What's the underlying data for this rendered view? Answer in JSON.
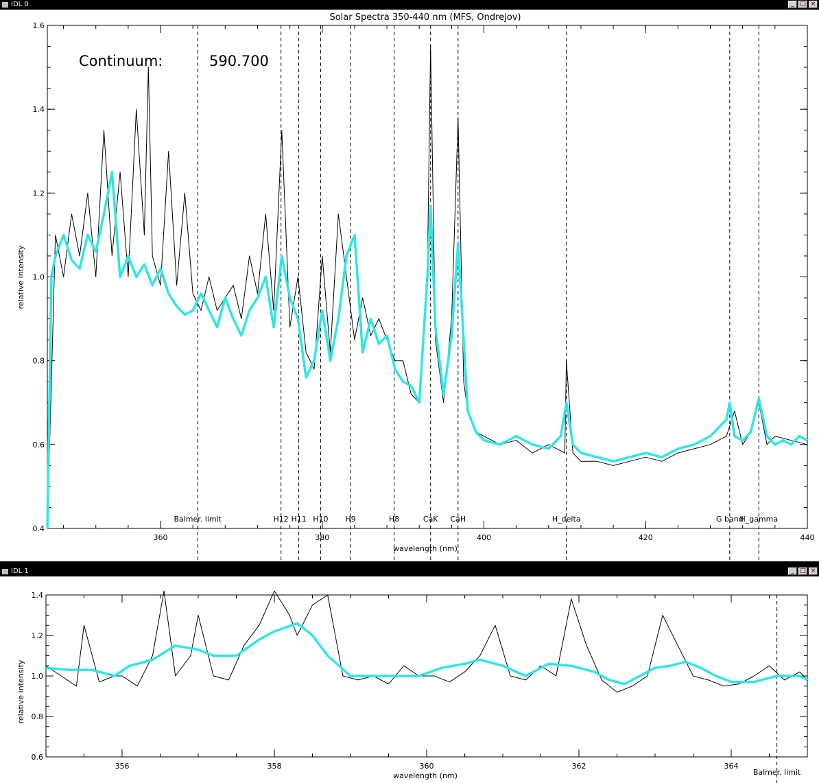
{
  "windows": [
    {
      "title": "IDL 0"
    },
    {
      "title": "IDL 1"
    }
  ],
  "window_buttons": {
    "minimize": "_",
    "maximize": "□",
    "close": "×"
  },
  "colors": {
    "spectrum": "#000000",
    "smoothed": "#2ee6e6",
    "background": "#ffffff"
  },
  "chart_data": [
    {
      "type": "line",
      "title": "Solar Spectra 350-440 nm (MFS, Ondrejov)",
      "xlabel": "wavelength (nm)",
      "ylabel": "relative intensity",
      "xlim": [
        346,
        440
      ],
      "ylim": [
        0.4,
        1.6
      ],
      "xticks": [
        360,
        380,
        400,
        420,
        440
      ],
      "yticks": [
        0.4,
        0.6,
        0.8,
        1.0,
        1.2,
        1.4,
        1.6
      ],
      "ytick_labels": [
        "0.4",
        "0.6",
        "0.8",
        "1.0",
        "1.2",
        "1.4",
        "1.6"
      ],
      "annotation_label": "Continuum:",
      "annotation_value": "590.700",
      "line_markers": [
        {
          "label": "Balmer. limit",
          "x": 364.6
        },
        {
          "label": "H12",
          "x": 374.9
        },
        {
          "label": "H11",
          "x": 377.1
        },
        {
          "label": "H10",
          "x": 379.8
        },
        {
          "label": "H9",
          "x": 383.5
        },
        {
          "label": "H8",
          "x": 388.9
        },
        {
          "label": "CaK",
          "x": 393.4
        },
        {
          "label": "CaH",
          "x": 396.8
        },
        {
          "label": "H_delta",
          "x": 410.2
        },
        {
          "label": "G band",
          "x": 430.4
        },
        {
          "label": "H_gamma",
          "x": 434.0
        }
      ],
      "series": [
        {
          "color": "#000000",
          "x": [
            346.0,
            347.0,
            348.0,
            349.0,
            350.0,
            351.0,
            352.0,
            353.0,
            354.0,
            355.0,
            356.0,
            357.0,
            358.0,
            358.5,
            359.0,
            360.0,
            361.0,
            362.0,
            363.0,
            364.0,
            365.0,
            366.0,
            367.0,
            368.0,
            369.0,
            370.0,
            371.0,
            372.0,
            373.0,
            374.0,
            375.0,
            376.0,
            377.0,
            378.0,
            379.0,
            380.0,
            381.0,
            382.0,
            383.0,
            384.0,
            385.0,
            386.0,
            387.0,
            388.0,
            389.0,
            390.0,
            391.0,
            392.0,
            393.0,
            393.4,
            394.0,
            395.0,
            396.0,
            396.8,
            397.5,
            398.0,
            399.0,
            400.0,
            402.0,
            404.0,
            406.0,
            408.0,
            410.0,
            410.2,
            411.0,
            412.0,
            414.0,
            416.0,
            418.0,
            420.0,
            422.0,
            424.0,
            426.0,
            428.0,
            430.0,
            431.0,
            432.0,
            433.0,
            434.0,
            435.0,
            436.0,
            438.0,
            440.0
          ],
          "y": [
            0.4,
            1.1,
            1.0,
            1.15,
            1.05,
            1.2,
            1.0,
            1.35,
            1.05,
            1.25,
            1.0,
            1.4,
            1.1,
            1.5,
            1.05,
            0.98,
            1.3,
            0.98,
            1.2,
            0.96,
            0.92,
            1.0,
            0.92,
            0.95,
            0.98,
            0.9,
            1.05,
            0.96,
            1.15,
            0.92,
            1.35,
            0.88,
            1.0,
            0.82,
            0.78,
            1.05,
            0.82,
            1.15,
            1.0,
            0.85,
            0.95,
            0.86,
            0.9,
            0.85,
            0.8,
            0.8,
            0.72,
            0.7,
            1.0,
            1.55,
            0.85,
            0.7,
            0.9,
            1.38,
            0.75,
            0.68,
            0.63,
            0.62,
            0.6,
            0.61,
            0.58,
            0.6,
            0.58,
            0.8,
            0.58,
            0.56,
            0.56,
            0.55,
            0.56,
            0.57,
            0.56,
            0.58,
            0.59,
            0.6,
            0.62,
            0.68,
            0.6,
            0.63,
            0.7,
            0.6,
            0.62,
            0.61,
            0.6
          ]
        },
        {
          "color": "#2ee6e6",
          "x": [
            346.0,
            346.5,
            347.0,
            348.0,
            349.0,
            350.0,
            351.0,
            352.0,
            353.0,
            354.0,
            355.0,
            356.0,
            357.0,
            358.0,
            359.0,
            360.0,
            361.0,
            362.0,
            363.0,
            364.0,
            365.0,
            366.0,
            367.0,
            368.0,
            369.0,
            370.0,
            371.0,
            372.0,
            373.0,
            374.0,
            375.0,
            376.0,
            377.0,
            378.0,
            379.0,
            380.0,
            381.0,
            382.0,
            383.0,
            384.0,
            385.0,
            386.0,
            387.0,
            388.0,
            389.0,
            390.0,
            391.0,
            392.0,
            393.0,
            393.4,
            394.0,
            395.0,
            396.0,
            396.8,
            397.5,
            398.0,
            399.0,
            400.0,
            402.0,
            404.0,
            406.0,
            408.0,
            409.5,
            410.2,
            411.0,
            412.0,
            414.0,
            416.0,
            418.0,
            420.0,
            422.0,
            424.0,
            426.0,
            428.0,
            430.0,
            430.4,
            431.0,
            432.0,
            433.0,
            434.0,
            435.0,
            436.0,
            437.0,
            438.0,
            439.0,
            440.0
          ],
          "y": [
            0.4,
            1.0,
            1.05,
            1.1,
            1.04,
            1.02,
            1.1,
            1.06,
            1.15,
            1.25,
            1.0,
            1.05,
            1.0,
            1.03,
            0.98,
            1.02,
            0.96,
            0.93,
            0.91,
            0.92,
            0.96,
            0.92,
            0.88,
            0.95,
            0.9,
            0.86,
            0.92,
            0.95,
            1.0,
            0.88,
            1.05,
            0.95,
            0.9,
            0.76,
            0.8,
            0.92,
            0.8,
            0.9,
            1.05,
            1.1,
            0.82,
            0.9,
            0.84,
            0.86,
            0.78,
            0.75,
            0.74,
            0.7,
            1.0,
            1.17,
            0.88,
            0.72,
            0.86,
            1.08,
            0.85,
            0.68,
            0.63,
            0.61,
            0.6,
            0.62,
            0.6,
            0.59,
            0.62,
            0.7,
            0.6,
            0.58,
            0.57,
            0.56,
            0.57,
            0.58,
            0.57,
            0.59,
            0.6,
            0.62,
            0.66,
            0.7,
            0.62,
            0.61,
            0.63,
            0.71,
            0.62,
            0.6,
            0.61,
            0.6,
            0.62,
            0.61
          ]
        }
      ]
    },
    {
      "type": "line",
      "title": "",
      "xlabel": "wavelength (nm)",
      "ylabel": "relative intensity",
      "xlim": [
        355,
        365
      ],
      "ylim": [
        0.6,
        1.4
      ],
      "xticks": [
        356,
        358,
        360,
        362,
        364
      ],
      "yticks": [
        0.6,
        0.8,
        1.0,
        1.2,
        1.4
      ],
      "ytick_labels": [
        "0.6",
        "0.8",
        "1.0",
        "1.2",
        "1.4"
      ],
      "line_markers": [
        {
          "label": "Balmer. limit",
          "x": 364.6
        }
      ],
      "series": [
        {
          "color": "#000000",
          "x": [
            355.0,
            355.2,
            355.4,
            355.5,
            355.7,
            355.9,
            356.0,
            356.2,
            356.4,
            356.55,
            356.7,
            356.9,
            357.0,
            357.2,
            357.4,
            357.6,
            357.8,
            358.0,
            358.2,
            358.3,
            358.5,
            358.7,
            358.9,
            359.1,
            359.3,
            359.5,
            359.7,
            359.9,
            360.1,
            360.3,
            360.5,
            360.7,
            360.9,
            361.1,
            361.3,
            361.5,
            361.7,
            361.9,
            362.1,
            362.3,
            362.5,
            362.7,
            362.9,
            363.1,
            363.3,
            363.5,
            363.7,
            363.9,
            364.1,
            364.3,
            364.5,
            364.7,
            364.9,
            365.0
          ],
          "y": [
            1.05,
            1.0,
            0.95,
            1.25,
            0.97,
            1.0,
            1.0,
            0.95,
            1.1,
            1.42,
            1.0,
            1.1,
            1.3,
            1.0,
            0.98,
            1.15,
            1.25,
            1.42,
            1.3,
            1.2,
            1.35,
            1.4,
            1.0,
            0.98,
            1.0,
            0.96,
            1.05,
            1.0,
            1.0,
            0.97,
            1.02,
            1.1,
            1.25,
            1.0,
            0.98,
            1.05,
            1.0,
            1.38,
            1.15,
            0.98,
            0.92,
            0.95,
            1.0,
            1.3,
            1.15,
            1.0,
            0.98,
            0.95,
            0.96,
            1.0,
            1.05,
            0.98,
            1.02,
            0.98
          ]
        },
        {
          "color": "#2ee6e6",
          "x": [
            355.0,
            355.3,
            355.6,
            355.9,
            356.1,
            356.4,
            356.7,
            357.0,
            357.2,
            357.5,
            357.8,
            358.0,
            358.3,
            358.5,
            358.7,
            359.0,
            359.3,
            359.6,
            359.9,
            360.2,
            360.5,
            360.7,
            361.0,
            361.3,
            361.6,
            361.9,
            362.2,
            362.4,
            362.6,
            362.8,
            363.0,
            363.2,
            363.4,
            363.6,
            363.8,
            364.0,
            364.3,
            364.6,
            364.9,
            365.0
          ],
          "y": [
            1.04,
            1.03,
            1.03,
            1.0,
            1.05,
            1.08,
            1.15,
            1.13,
            1.1,
            1.1,
            1.18,
            1.22,
            1.26,
            1.2,
            1.1,
            1.0,
            1.0,
            1.0,
            1.0,
            1.04,
            1.06,
            1.08,
            1.05,
            1.0,
            1.06,
            1.05,
            1.02,
            0.98,
            0.96,
            1.0,
            1.04,
            1.05,
            1.07,
            1.04,
            1.0,
            0.97,
            0.97,
            1.0,
            1.0,
            0.98
          ]
        }
      ]
    }
  ]
}
